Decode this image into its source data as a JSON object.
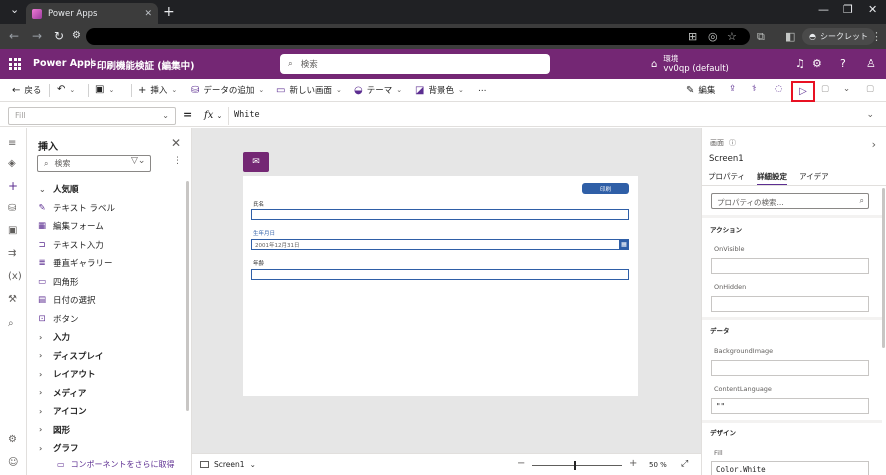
{
  "browser": {
    "tab_title": "Power Apps",
    "tab_close": "✕",
    "new_tab": "+",
    "incognito_label": "シークレット"
  },
  "header": {
    "brand": "Power Apps",
    "separator": "|",
    "app_name": "印刷機能検証 (編集中)",
    "search_placeholder": "検索",
    "env_label": "環境",
    "env_name": "vv0qp (default)"
  },
  "commands": {
    "back": "戻る",
    "insert": "挿入",
    "add_data": "データの追加",
    "new_screen": "新しい画面",
    "theme": "テーマ",
    "background": "背景色",
    "more": "…",
    "edit": "編集"
  },
  "formula": {
    "property": "Fill",
    "fx": "fx",
    "value": "White"
  },
  "insert_pane": {
    "title": "挿入",
    "search_placeholder": "検索",
    "items": [
      {
        "kind": "group",
        "label": "人気順",
        "arrow": "⌄"
      },
      {
        "kind": "item",
        "label": "テキスト ラベル",
        "icon": "✎"
      },
      {
        "kind": "item",
        "label": "編集フォーム",
        "icon": "▦"
      },
      {
        "kind": "item",
        "label": "テキスト入力",
        "icon": "⊐"
      },
      {
        "kind": "item",
        "label": "垂直ギャラリー",
        "icon": "≣"
      },
      {
        "kind": "item",
        "label": "四角形",
        "icon": "▭"
      },
      {
        "kind": "item",
        "label": "日付の選択",
        "icon": "▤"
      },
      {
        "kind": "item",
        "label": "ボタン",
        "icon": "⊡"
      },
      {
        "kind": "group",
        "label": "入力",
        "arrow": "›"
      },
      {
        "kind": "group",
        "label": "ディスプレイ",
        "arrow": "›"
      },
      {
        "kind": "group",
        "label": "レイアウト",
        "arrow": "›"
      },
      {
        "kind": "group",
        "label": "メディア",
        "arrow": "›"
      },
      {
        "kind": "group",
        "label": "アイコン",
        "arrow": "›"
      },
      {
        "kind": "group",
        "label": "図形",
        "arrow": "›"
      },
      {
        "kind": "group",
        "label": "グラフ",
        "arrow": "›"
      }
    ],
    "footer": "コンポーネントをさらに取得"
  },
  "canvas": {
    "print_button": "印刷",
    "name_label": "氏名",
    "birth_label": "生年月日",
    "birth_value": "2001年12月31日",
    "age_label": "年齢"
  },
  "statusbar": {
    "screen": "Screen1",
    "zoom": "50 %",
    "zoom_level": 0.5
  },
  "properties": {
    "type_label": "画面",
    "name": "Screen1",
    "tabs": [
      "プロパティ",
      "詳細設定",
      "アイデア"
    ],
    "search_placeholder": "プロパティの検索...",
    "section_actions": "アクション",
    "on_visible": "OnVisible",
    "on_hidden": "OnHidden",
    "section_data": "データ",
    "background_image": "BackgroundImage",
    "content_language": "ContentLanguage",
    "content_language_value": "\"\"",
    "section_design": "デザイン",
    "fill": "Fill",
    "fill_value": "Color.White"
  },
  "colors": {
    "brand": "#742774",
    "accent": "#5c2e91",
    "form_blue": "#2f5fa7",
    "highlight": "#e81123"
  }
}
